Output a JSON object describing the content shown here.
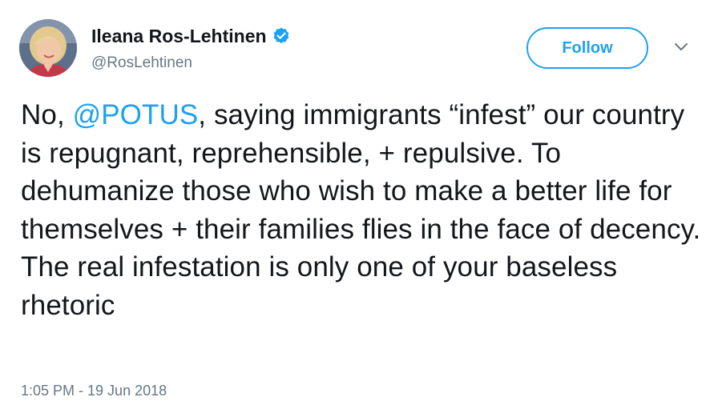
{
  "user": {
    "display_name": "Ileana Ros-Lehtinen",
    "handle": "@RosLehtinen",
    "verified": true
  },
  "actions": {
    "follow_label": "Follow"
  },
  "tweet": {
    "text_prefix": "No, ",
    "mention": "@POTUS",
    "text_body": ", saying immigrants “infest” our country is repugnant, reprehensible, + repulsive. To dehumanize those who wish to make a better life for themselves + their families flies in the face of decency. The real infestation is only one of your baseless rhetoric",
    "timestamp": "1:05 PM - 19 Jun 2018"
  },
  "colors": {
    "accent": "#1da1f2",
    "text": "#14171a",
    "secondary_text": "#657786"
  },
  "icons": {
    "verified": "verified-badge-icon",
    "caret": "chevron-down-icon"
  }
}
